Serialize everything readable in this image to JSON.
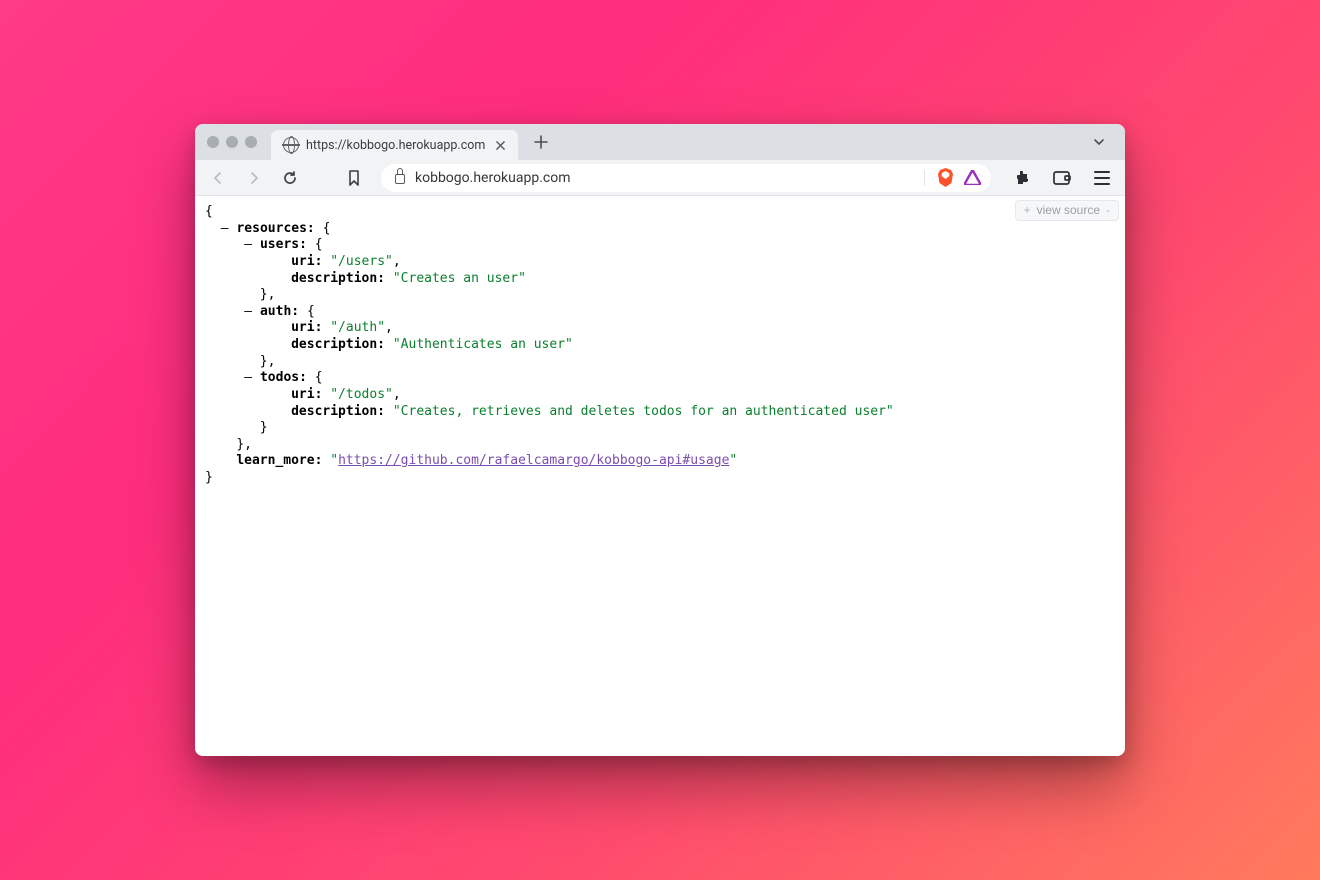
{
  "tab": {
    "title": "https://kobbogo.herokuapp.com"
  },
  "address": {
    "url": "kobbogo.herokuapp.com"
  },
  "viewsource": {
    "label": "view source",
    "plus": "+",
    "minus": "-"
  },
  "json": {
    "brace_open": "{",
    "brace_close": "}",
    "brace_close_comma": "},",
    "dash": "–",
    "comma": ",",
    "quote": "\"",
    "resources_key": "resources:",
    "users_key": "users:",
    "auth_key": "auth:",
    "todos_key": "todos:",
    "uri_key": "uri:",
    "description_key": "description:",
    "learn_more_key": "learn_more:",
    "users_uri": "\"/users\"",
    "users_desc": "\"Creates an user\"",
    "auth_uri": "\"/auth\"",
    "auth_desc": "\"Authenticates an user\"",
    "todos_uri": "\"/todos\"",
    "todos_desc": "\"Creates, retrieves and deletes todos for an authenticated user\"",
    "learn_more_url": "https://github.com/rafaelcamargo/kobbogo-api#usage"
  }
}
